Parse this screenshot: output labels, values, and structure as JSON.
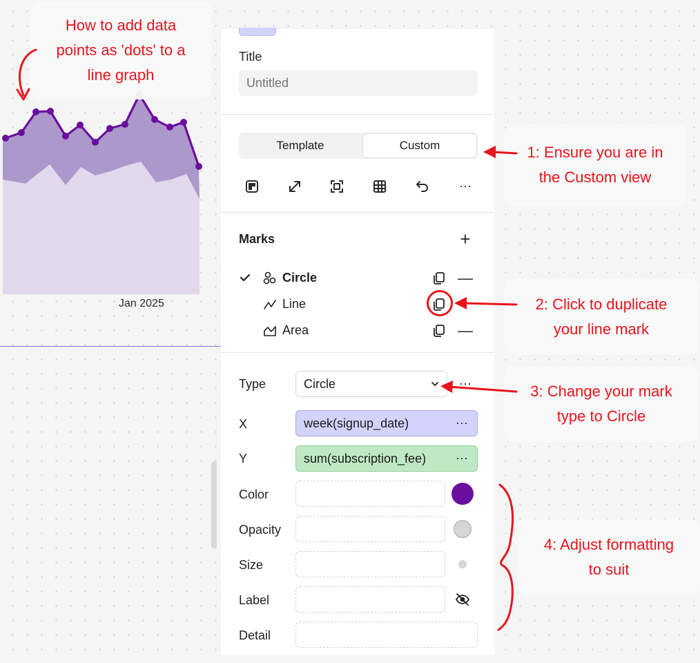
{
  "annotations": {
    "intro": "How to add data\npoints as 'dots' to a\nline graph",
    "step1": "1: Ensure you are in\nthe Custom view",
    "step2": "2: Click to duplicate\nyour line mark",
    "step3": "3: Change your mark\ntype to Circle",
    "step4": "4: Adjust formatting\nto suit"
  },
  "chart": {
    "x_tick_label": "Jan 2025",
    "line_color": "#6a0e9e",
    "area_dark_color": "#ad98cc",
    "area_light_color": "#e2d8ec"
  },
  "panel": {
    "title_label": "Title",
    "title_placeholder": "Untitled",
    "view_tabs": [
      {
        "label": "Template",
        "selected": false
      },
      {
        "label": "Custom",
        "selected": true
      }
    ],
    "toolbar_icons": [
      "layout-icon",
      "expand-icon",
      "fit-icon",
      "table-icon",
      "undo-icon",
      "more-icon"
    ],
    "marks_heading": "Marks",
    "marks": [
      {
        "label": "Circle",
        "active": true,
        "icon": "circle-mark-icon"
      },
      {
        "label": "Line",
        "active": false,
        "icon": "line-mark-icon"
      },
      {
        "label": "Area",
        "active": false,
        "icon": "area-mark-icon"
      }
    ],
    "encodings": {
      "type_label": "Type",
      "type_value": "Circle",
      "x_label": "X",
      "x_value": "week(signup_date)",
      "y_label": "Y",
      "y_value": "sum(subscription_fee)",
      "color_label": "Color",
      "color_value": "#6a0e9e",
      "opacity_label": "Opacity",
      "size_label": "Size",
      "label_label": "Label",
      "detail_label": "Detail"
    },
    "accent_colors": {
      "x_pill": "#d3d3fd",
      "y_pill": "#bfe9c4",
      "annotation_red": "#e8141b"
    }
  }
}
